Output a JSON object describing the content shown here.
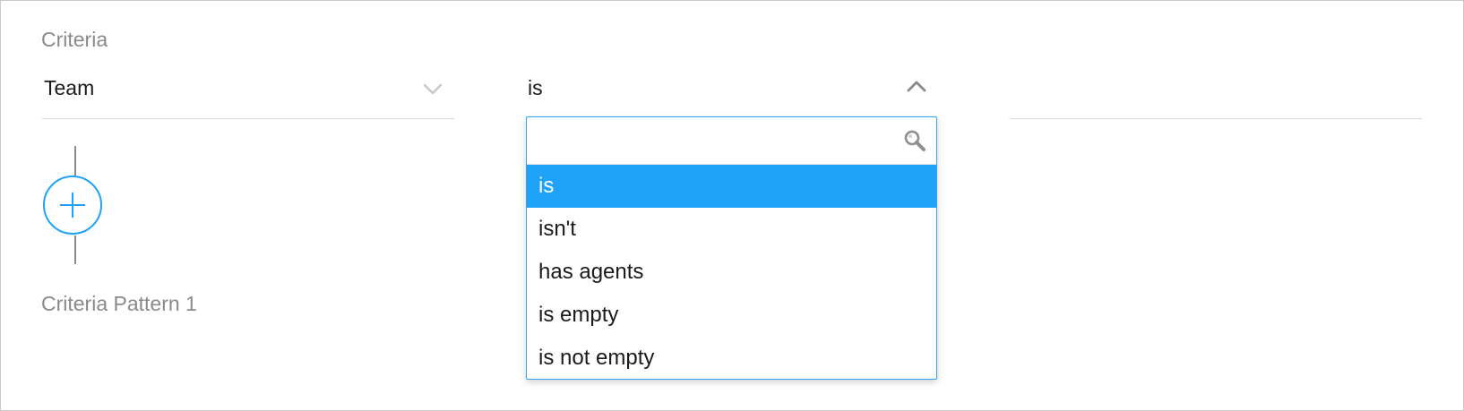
{
  "criteria": {
    "title": "Criteria",
    "field": {
      "value": "Team",
      "icon": "chevron-down-icon"
    },
    "operator": {
      "value": "is",
      "icon": "chevron-up-icon",
      "search_placeholder": "",
      "search_icon": "search-icon",
      "options": [
        {
          "label": "is",
          "selected": true
        },
        {
          "label": "isn't",
          "selected": false
        },
        {
          "label": "has agents",
          "selected": false
        },
        {
          "label": "is empty",
          "selected": false
        },
        {
          "label": "is not empty",
          "selected": false
        }
      ]
    },
    "value_field": {
      "value": ""
    },
    "add_icon": "plus-circle-icon",
    "pattern_label": "Criteria Pattern 1"
  },
  "colors": {
    "accent": "#1fa3f8",
    "label_gray": "#8a8a8a",
    "text": "#1a1a1a",
    "divider": "#d9dde3"
  }
}
